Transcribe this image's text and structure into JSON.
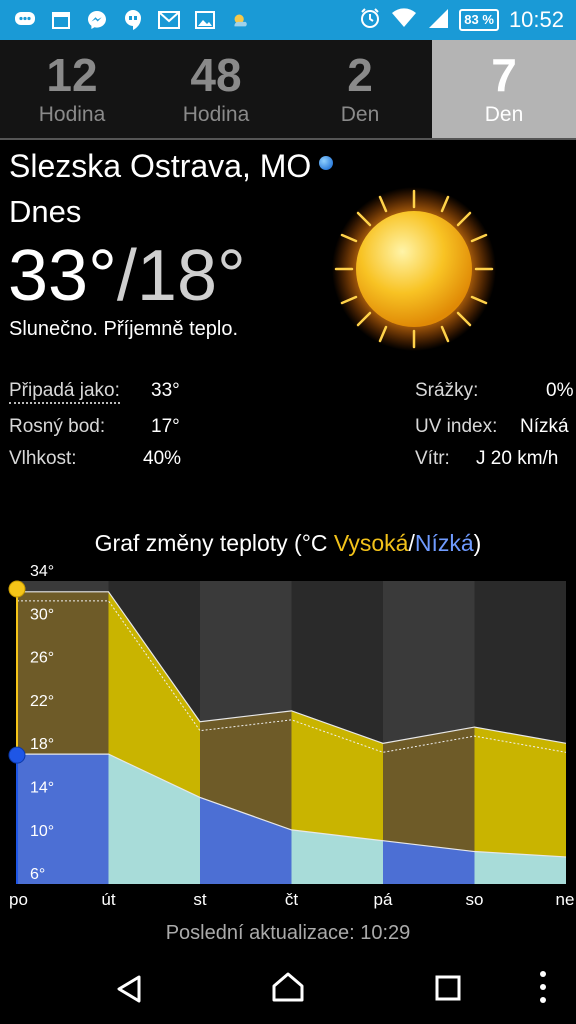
{
  "status_bar": {
    "left_icons": [
      "chat-icon",
      "calendar-icon",
      "messenger-icon",
      "hangouts-icon",
      "gmail-icon",
      "gallery-icon",
      "weather-widget-icon"
    ],
    "right_icons": [
      "alarm-icon",
      "wifi-icon",
      "signal-icon"
    ],
    "calendar_day": "1",
    "battery": "83 %",
    "time": "10:52"
  },
  "tabs": [
    {
      "num": "12",
      "label": "Hodina"
    },
    {
      "num": "48",
      "label": "Hodina"
    },
    {
      "num": "2",
      "label": "Den"
    },
    {
      "num": "7",
      "label": "Den"
    }
  ],
  "location": "Slezska Ostrava, MO",
  "day": "Dnes",
  "temp_high": "33°",
  "temp_sep": "/",
  "temp_low": "18°",
  "condition": "Slunečno. Příjemně teplo.",
  "details": {
    "feels_label": "Připadá jako:",
    "feels_value": "33°",
    "dew_label": "Rosný bod:",
    "dew_value": "17°",
    "humidity_label": "Vlhkost:",
    "humidity_value": "40%",
    "precip_label": "Srážky:",
    "precip_value": "0%",
    "uv_label": "UV index:",
    "uv_value": "Nízká",
    "wind_label": "Vítr:",
    "wind_value": "J 20 km/h"
  },
  "chart_title": {
    "prefix": "Graf změny teploty (°C ",
    "high": "Vysoká",
    "sep": "/",
    "low": "Nízká",
    "suffix": ")"
  },
  "chart_data": {
    "type": "area",
    "x": [
      "po",
      "út",
      "st",
      "čt",
      "pá",
      "so",
      "ne"
    ],
    "y_ticks": [
      "34°",
      "30°",
      "26°",
      "22°",
      "18°",
      "14°",
      "10°",
      "6°"
    ],
    "ylim": [
      6,
      34
    ],
    "series": [
      {
        "name": "Vysoká",
        "values": [
          33,
          33,
          21,
          22,
          19,
          20.5,
          19
        ]
      },
      {
        "name": "Nízká",
        "values": [
          18,
          18,
          14,
          11,
          10,
          9,
          8.5
        ]
      }
    ],
    "colors": {
      "high": "#c9b400",
      "high_dark": "#6e5b28",
      "low": "#4c6fd4",
      "low_light": "#a8dcd9",
      "bg_dark": "#2a2a2a",
      "bg_light": "#3a3a3a",
      "high_marker": "#f5c518",
      "low_marker": "#1e56e6"
    }
  },
  "footer": "Poslední aktualizace: 10:29",
  "nav": [
    "back-icon",
    "home-icon",
    "recents-icon",
    "more-icon"
  ]
}
